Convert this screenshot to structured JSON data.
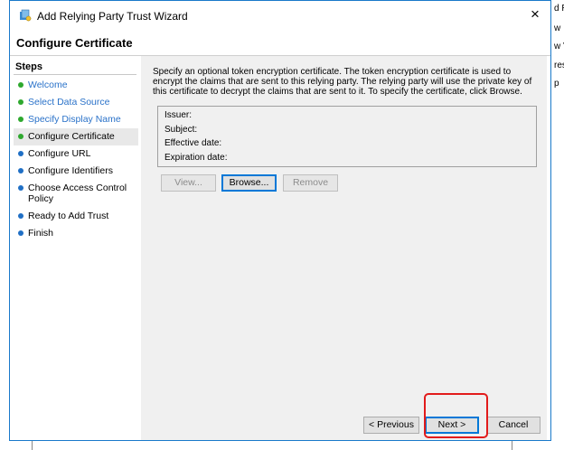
{
  "background_fragments": [
    "d R",
    "w",
    "w V",
    "res",
    "p"
  ],
  "window": {
    "title": "Add Relying Party Trust Wizard",
    "icon": "relying-party-wizard-icon",
    "close_glyph": "×"
  },
  "page_title": "Configure Certificate",
  "steps": {
    "heading": "Steps",
    "items": [
      {
        "label": "Welcome",
        "state": "done"
      },
      {
        "label": "Select Data Source",
        "state": "done"
      },
      {
        "label": "Specify Display Name",
        "state": "done"
      },
      {
        "label": "Configure Certificate",
        "state": "current"
      },
      {
        "label": "Configure URL",
        "state": "todo"
      },
      {
        "label": "Configure Identifiers",
        "state": "todo"
      },
      {
        "label": "Choose Access Control Policy",
        "state": "todo"
      },
      {
        "label": "Ready to Add Trust",
        "state": "todo"
      },
      {
        "label": "Finish",
        "state": "todo"
      }
    ]
  },
  "content": {
    "description": "Specify an optional token encryption certificate.  The token encryption certificate is used to encrypt the claims that are sent to this relying party.  The relying party will use the private key of this certificate to decrypt the claims that are sent to it.  To specify the certificate, click Browse.",
    "certificate": {
      "issuer_label": "Issuer:",
      "subject_label": "Subject:",
      "effective_label": "Effective date:",
      "expiration_label": "Expiration date:"
    },
    "buttons": {
      "view": "View...",
      "browse": "Browse...",
      "remove": "Remove"
    }
  },
  "footer": {
    "previous": "< Previous",
    "next": "Next >",
    "cancel": "Cancel"
  },
  "colors": {
    "window_border": "#1979ca",
    "link_blue": "#2a72c9",
    "done_dot": "#2ea82e",
    "todo_dot": "#1f6fc5",
    "highlight_red": "#e21b1b"
  }
}
